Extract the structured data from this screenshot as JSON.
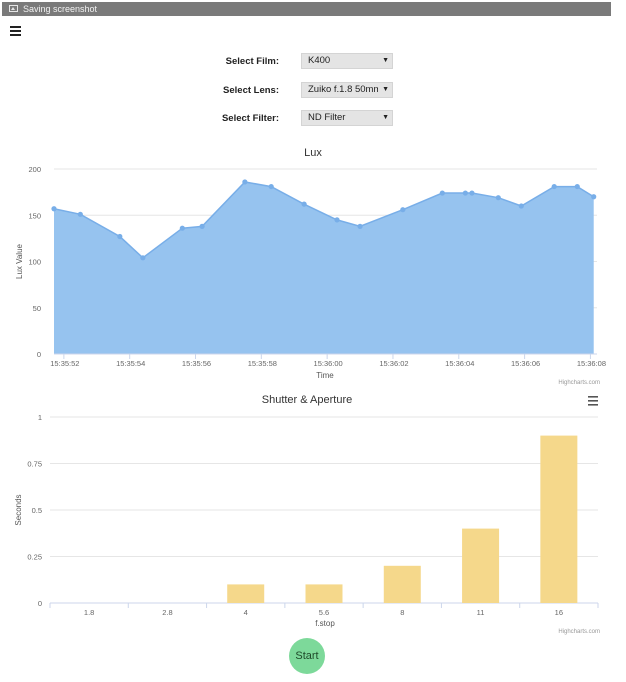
{
  "window": {
    "title": "Saving screenshot"
  },
  "menu": {
    "icon": "hamburger-menu-icon"
  },
  "form": {
    "film_label": "Select Film:",
    "film_value": "K400",
    "lens_label": "Select Lens:",
    "lens_value": "Zuiko f.1.8 50mm",
    "filter_label": "Select Filter:",
    "filter_value": "ND Filter"
  },
  "start_label": "Start",
  "chart_data": [
    {
      "type": "area",
      "title": "Lux",
      "xlabel": "Time",
      "ylabel": "Lux Value",
      "ylim": [
        0,
        200
      ],
      "yticks": [
        0,
        50,
        100,
        150,
        200
      ],
      "xticks": [
        "15:35:52",
        "15:35:54",
        "15:35:56",
        "15:35:58",
        "15:36:00",
        "15:36:02",
        "15:36:04",
        "15:36:06",
        "15:36:08"
      ],
      "x_seconds": [
        0.0,
        0.8,
        2.0,
        2.7,
        3.9,
        4.5,
        5.8,
        6.6,
        7.6,
        8.6,
        9.3,
        10.6,
        11.8,
        12.5,
        12.7,
        13.5,
        14.2,
        15.2,
        15.9,
        16.4
      ],
      "values": [
        157,
        151,
        127,
        104,
        136,
        138,
        186,
        181,
        162,
        145,
        138,
        156,
        174,
        174,
        174,
        169,
        160,
        181,
        181,
        170
      ],
      "x_start": "15:35:51.7",
      "xlim_seconds": [
        0,
        16.5
      ],
      "fill": "#96c3ef",
      "line": "#78aee8",
      "credit": "Highcharts.com"
    },
    {
      "type": "bar",
      "title": "Shutter & Aperture",
      "xlabel": "f.stop",
      "ylabel": "Seconds",
      "ylim": [
        0,
        1
      ],
      "yticks": [
        "0",
        "0.25",
        "0.5",
        "0.75",
        "1"
      ],
      "categories": [
        "1.8",
        "2.8",
        "4",
        "5.6",
        "8",
        "11",
        "16"
      ],
      "values": [
        0,
        0,
        0.1,
        0.1,
        0.2,
        0.4,
        0.9
      ],
      "color": "#f5d88b",
      "credit": "Highcharts.com",
      "menu_icon": "chart-context-menu-icon"
    }
  ]
}
